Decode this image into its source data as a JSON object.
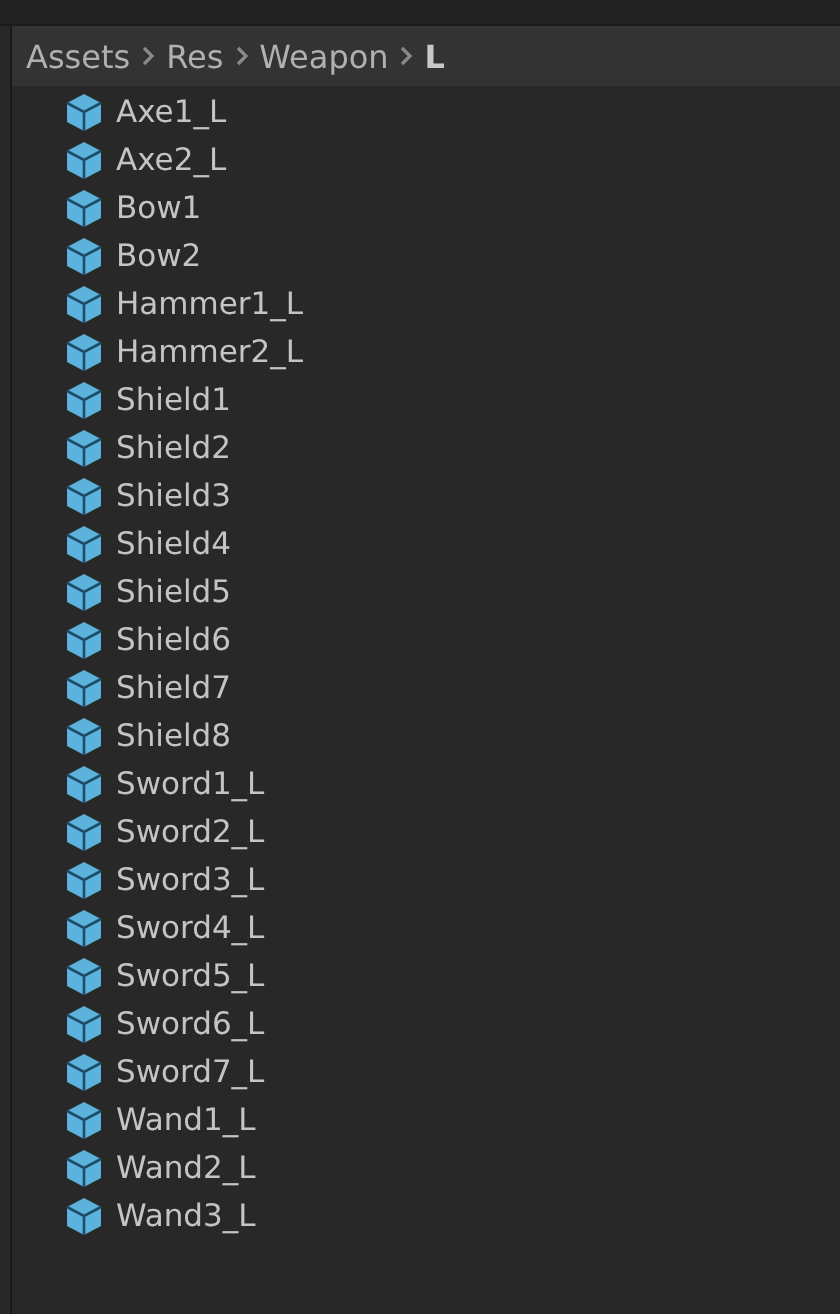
{
  "breadcrumb": [
    {
      "label": "Assets",
      "current": false
    },
    {
      "label": "Res",
      "current": false
    },
    {
      "label": "Weapon",
      "current": false
    },
    {
      "label": "L",
      "current": true
    }
  ],
  "items": [
    "Axe1_L",
    "Axe2_L",
    "Bow1",
    "Bow2",
    "Hammer1_L",
    "Hammer2_L",
    "Shield1",
    "Shield2",
    "Shield3",
    "Shield4",
    "Shield5",
    "Shield6",
    "Shield7",
    "Shield8",
    "Sword1_L",
    "Sword2_L",
    "Sword3_L",
    "Sword4_L",
    "Sword5_L",
    "Sword6_L",
    "Sword7_L",
    "Wand1_L",
    "Wand2_L",
    "Wand3_L"
  ]
}
